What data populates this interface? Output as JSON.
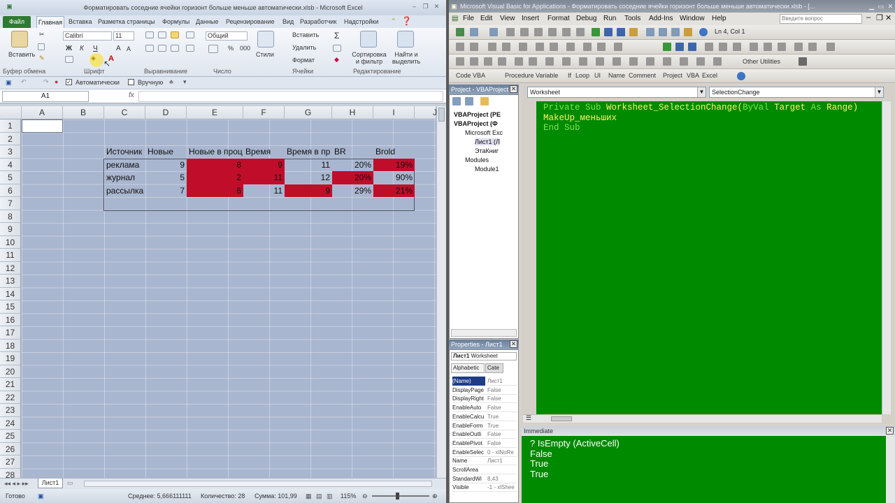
{
  "excel": {
    "title": "Форматировать соседние ячейки горизонт больше меньше автоматически.xlsb - Microsoft Excel",
    "tabs": [
      "Файл",
      "Главная",
      "Вставка",
      "Разметка страницы",
      "Формулы",
      "Данные",
      "Рецензирование",
      "Вид",
      "Разработчик",
      "Надстройки"
    ],
    "ribbon": {
      "paste": "Вставить",
      "font_name": "Calibri",
      "font_size": "11",
      "number_format": "Общий",
      "styles": "Стили",
      "insert": "Вставить",
      "delete": "Удалить",
      "format": "Формат",
      "sort_filter": "Сортировка и фильтр",
      "find_select": "Найти и выделить",
      "groups": [
        "Буфер обмена",
        "Шрифт",
        "Выравнивание",
        "Число",
        "Ячейки",
        "Редактирование"
      ],
      "bold": "Ж",
      "italic": "К",
      "underline": "Ч"
    },
    "qat": {
      "auto_label": "Автоматически",
      "manual_label": "Вручную"
    },
    "namebox": "A1",
    "fx": "fx",
    "columns": [
      "A",
      "B",
      "C",
      "D",
      "E",
      "F",
      "G",
      "H",
      "I",
      "J"
    ],
    "rows": [
      "1",
      "2",
      "3",
      "4",
      "5",
      "6",
      "7",
      "8",
      "9",
      "10",
      "11",
      "12",
      "13",
      "14",
      "15",
      "16",
      "17",
      "18",
      "19",
      "20",
      "21",
      "22",
      "23",
      "24",
      "25",
      "26",
      "27",
      "28"
    ],
    "table": {
      "headers": [
        "Источник",
        "Новые",
        "Новые в проц",
        "Время",
        "Время в пр",
        "BR",
        "Brold"
      ],
      "rows": [
        [
          "реклама",
          "9",
          "8",
          "9",
          "11",
          "20%",
          "19%"
        ],
        [
          "журнал",
          "5",
          "2",
          "11",
          "12",
          "20%",
          "90%"
        ],
        [
          "рассылка",
          "7",
          "6",
          "11",
          "9",
          "29%",
          "21%"
        ]
      ]
    },
    "sheet_tab": "Лист1",
    "status": {
      "ready": "Готово",
      "average": "Среднее: 5,666111111",
      "count": "Количество: 28",
      "sum": "Сумма: 101,99",
      "zoom": "115%"
    },
    "colors": {
      "highlight": "#c00d2a",
      "sheet_bg": "#a9b6cf",
      "file_tab": "#2f7a32"
    }
  },
  "vba": {
    "title": "Microsoft Visual Basic for Applications - Форматировать соседние ячейки горизонт больше меньше автоматически.xlsb - [...",
    "menu": [
      "File",
      "Edit",
      "View",
      "Insert",
      "Format",
      "Debug",
      "Run",
      "Tools",
      "Add-Ins",
      "Window",
      "Help"
    ],
    "search_placeholder": "Введите вопрос",
    "position": "Ln 4, Col 1",
    "toolbar3": [
      "Code VBA",
      "Procedure",
      "Variable",
      "If",
      "Loop",
      "UI",
      "Name",
      "Comment",
      "Project",
      "VBA",
      "Excel"
    ],
    "other_utilities": "Other Utilities",
    "project_title": "Project - VBAProject",
    "tree": [
      "VBAProject (PE",
      "VBAProject (Ф",
      "Microsoft Exc",
      "Лист1 (Л",
      "ЭтаКниг",
      "Modules",
      "Module1"
    ],
    "properties_title": "Properties - Лист1",
    "properties_object": "Лист1",
    "properties_type": "Worksheet",
    "prop_tabs": [
      "Alphabetic",
      "Cate"
    ],
    "properties": [
      [
        "(Name)",
        "Лист1"
      ],
      [
        "DisplayPage",
        "False"
      ],
      [
        "DisplayRight",
        "False"
      ],
      [
        "EnableAuto",
        "False"
      ],
      [
        "EnableCalcu",
        "True"
      ],
      [
        "EnableForm",
        "True"
      ],
      [
        "EnableOutli",
        "False"
      ],
      [
        "EnablePivot",
        "False"
      ],
      [
        "EnableSelec",
        "0 - xlNoRe"
      ],
      [
        "Name",
        "Лист1"
      ],
      [
        "ScrollArea",
        ""
      ],
      [
        "StandardWi",
        "8,43"
      ],
      [
        "Visible",
        "-1 - xlShee"
      ]
    ],
    "object_combo": "Worksheet",
    "proc_combo": "SelectionChange",
    "code": {
      "l1_kw1": "Private Sub",
      "l1_id": " Worksheet_SelectionChange(",
      "l1_kw2": "ByVal",
      "l1_id2": " Target ",
      "l1_kw3": "As",
      "l1_id3": " Range)",
      "l2": "MakeUp_меньших",
      "l3": "End Sub"
    },
    "immediate_title": "Immediate",
    "immediate": [
      "? IsEmpty (ActiveCell)",
      "False",
      "True",
      "True"
    ],
    "colors": {
      "code_bg": "#008a00",
      "keyword": "#7ee34a",
      "identifier": "#fff36a"
    }
  }
}
